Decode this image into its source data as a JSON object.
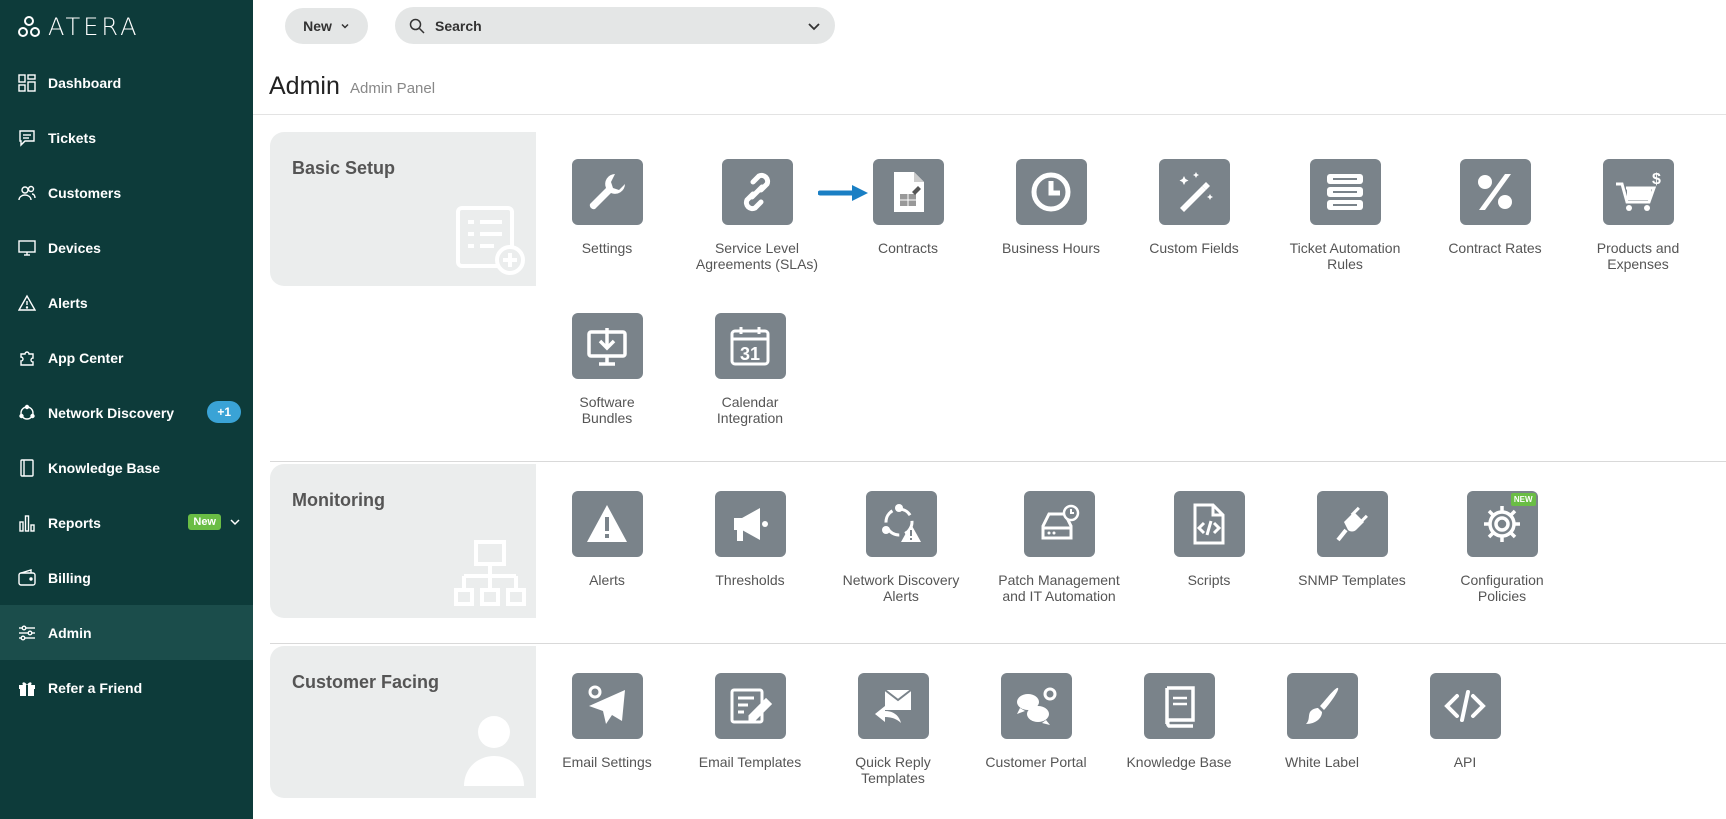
{
  "brand": {
    "name": "ATERA"
  },
  "colors": {
    "sidebar": "#0d3b3a",
    "tile": "#7a838a",
    "accent": "#3aa3d6",
    "new_badge": "#6abd45"
  },
  "sidebar": {
    "items": [
      {
        "label": "Dashboard",
        "icon": "dashboard-icon"
      },
      {
        "label": "Tickets",
        "icon": "ticket-icon"
      },
      {
        "label": "Customers",
        "icon": "customers-icon"
      },
      {
        "label": "Devices",
        "icon": "monitor-icon"
      },
      {
        "label": "Alerts",
        "icon": "warning-icon"
      },
      {
        "label": "App Center",
        "icon": "puzzle-icon"
      },
      {
        "label": "Network Discovery",
        "icon": "network-icon",
        "badge": "+1"
      },
      {
        "label": "Knowledge Base",
        "icon": "book-icon"
      },
      {
        "label": "Reports",
        "icon": "bar-chart-icon",
        "badge": "New"
      },
      {
        "label": "Billing",
        "icon": "wallet-icon"
      },
      {
        "label": "Admin",
        "icon": "sliders-icon",
        "active": true
      },
      {
        "label": "Refer a Friend",
        "icon": "gift-icon"
      }
    ]
  },
  "topbar": {
    "new_label": "New",
    "search_placeholder": "Search"
  },
  "page": {
    "title": "Admin",
    "subtitle": "Admin Panel"
  },
  "sections": {
    "basic": {
      "title": "Basic Setup",
      "tiles": [
        {
          "label1": "Settings",
          "label2": "",
          "icon": "wrench-icon"
        },
        {
          "label1": "Service Level",
          "label2": "Agreements (SLAs)",
          "icon": "link-icon"
        },
        {
          "label1": "Contracts",
          "label2": "",
          "icon": "contract-icon"
        },
        {
          "label1": "Business Hours",
          "label2": "",
          "icon": "clock-icon"
        },
        {
          "label1": "Custom Fields",
          "label2": "",
          "icon": "magic-wand-icon"
        },
        {
          "label1": "Ticket Automation",
          "label2": "Rules",
          "icon": "server-stack-icon"
        },
        {
          "label1": "Contract Rates",
          "label2": "",
          "icon": "percent-icon"
        },
        {
          "label1": "Products and",
          "label2": "Expenses",
          "icon": "cart-icon"
        },
        {
          "label1": "Software",
          "label2": "Bundles",
          "icon": "download-monitor-icon"
        },
        {
          "label1": "Calendar",
          "label2": "Integration",
          "icon": "calendar-icon",
          "icon_text": "31"
        }
      ]
    },
    "monitoring": {
      "title": "Monitoring",
      "tiles": [
        {
          "label1": "Alerts",
          "label2": "",
          "icon": "alert-triangle-icon"
        },
        {
          "label1": "Thresholds",
          "label2": "",
          "icon": "megaphone-icon"
        },
        {
          "label1": "Network Discovery",
          "label2": "Alerts",
          "icon": "network-alert-icon"
        },
        {
          "label1": "Patch Management",
          "label2": "and IT Automation",
          "icon": "drive-clock-icon"
        },
        {
          "label1": "Scripts",
          "label2": "",
          "icon": "code-file-icon"
        },
        {
          "label1": "SNMP Templates",
          "label2": "",
          "icon": "plug-icon"
        },
        {
          "label1": "Configuration",
          "label2": "Policies",
          "icon": "gear-icon",
          "badge": "NEW"
        }
      ]
    },
    "customer": {
      "title": "Customer Facing",
      "tiles": [
        {
          "label1": "Email Settings",
          "label2": "",
          "icon": "send-gear-icon"
        },
        {
          "label1": "Email Templates",
          "label2": "",
          "icon": "edit-template-icon"
        },
        {
          "label1": "Quick Reply",
          "label2": "Templates",
          "icon": "reply-mail-icon"
        },
        {
          "label1": "Customer Portal",
          "label2": "",
          "icon": "chat-gear-icon"
        },
        {
          "label1": "Knowledge Base",
          "label2": "",
          "icon": "book-icon"
        },
        {
          "label1": "White Label",
          "label2": "",
          "icon": "brush-icon"
        },
        {
          "label1": "API",
          "label2": "",
          "icon": "code-icon"
        }
      ]
    }
  }
}
